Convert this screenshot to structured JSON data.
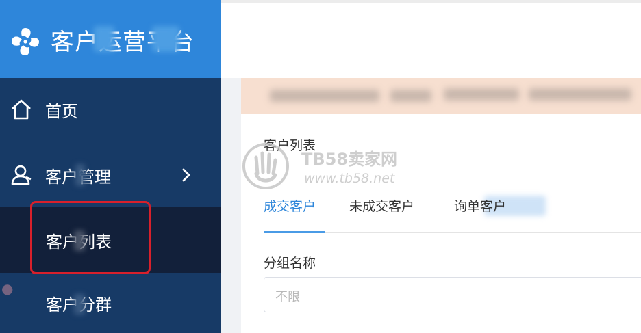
{
  "app": {
    "title": "客户运营平台"
  },
  "sidebar": {
    "home_label": "首页",
    "customers_label": "客户管理",
    "sub_items": [
      {
        "label": "客户列表",
        "active": true
      },
      {
        "label": "客户分群",
        "active": false
      }
    ]
  },
  "main": {
    "card_title": "客户列表",
    "tabs": [
      {
        "label": "成交客户",
        "active": true
      },
      {
        "label": "未成交客户",
        "active": false
      },
      {
        "label": "询单客户",
        "active": false
      }
    ],
    "filter": {
      "label": "分组名称",
      "placeholder": "不限"
    }
  },
  "watermark": {
    "text": "TB58卖家网",
    "url": "www.tb58.net"
  },
  "colors": {
    "sidebar": "#173a66",
    "brand": "#2e86da",
    "highlight": "#d8202b",
    "notice": "#f7dfd0"
  }
}
